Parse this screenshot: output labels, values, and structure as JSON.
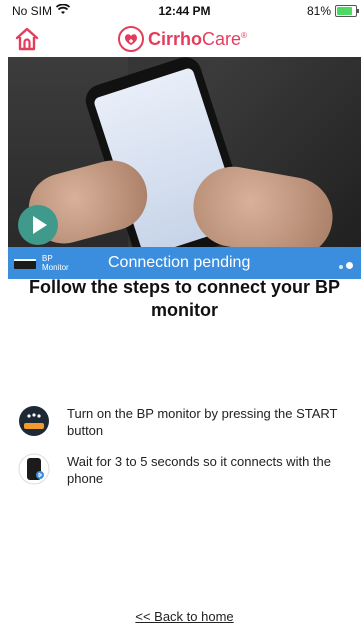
{
  "status_bar": {
    "carrier": "No SIM",
    "time": "12:44 PM",
    "battery": "81%",
    "battery_fraction": 0.81
  },
  "header": {
    "home_icon": "home-icon",
    "logo_bold": "Cirrho",
    "logo_light": "Care",
    "logo_reg": "®",
    "brand_color": "#e43d5c"
  },
  "video": {
    "play_icon": "play-icon"
  },
  "connection": {
    "device_label": "BP Monitor",
    "status": "Connection pending",
    "bar_color": "#3b8ede"
  },
  "main": {
    "title": "Follow the steps to connect your BP monitor",
    "steps": [
      {
        "icon": "bp-monitor-icon",
        "text": "Turn on the BP monitor by pressing the START button"
      },
      {
        "icon": "phone-bluetooth-icon",
        "text": "Wait for 3 to 5 seconds so it connects with the phone"
      }
    ],
    "back_link": "<< Back to home"
  }
}
